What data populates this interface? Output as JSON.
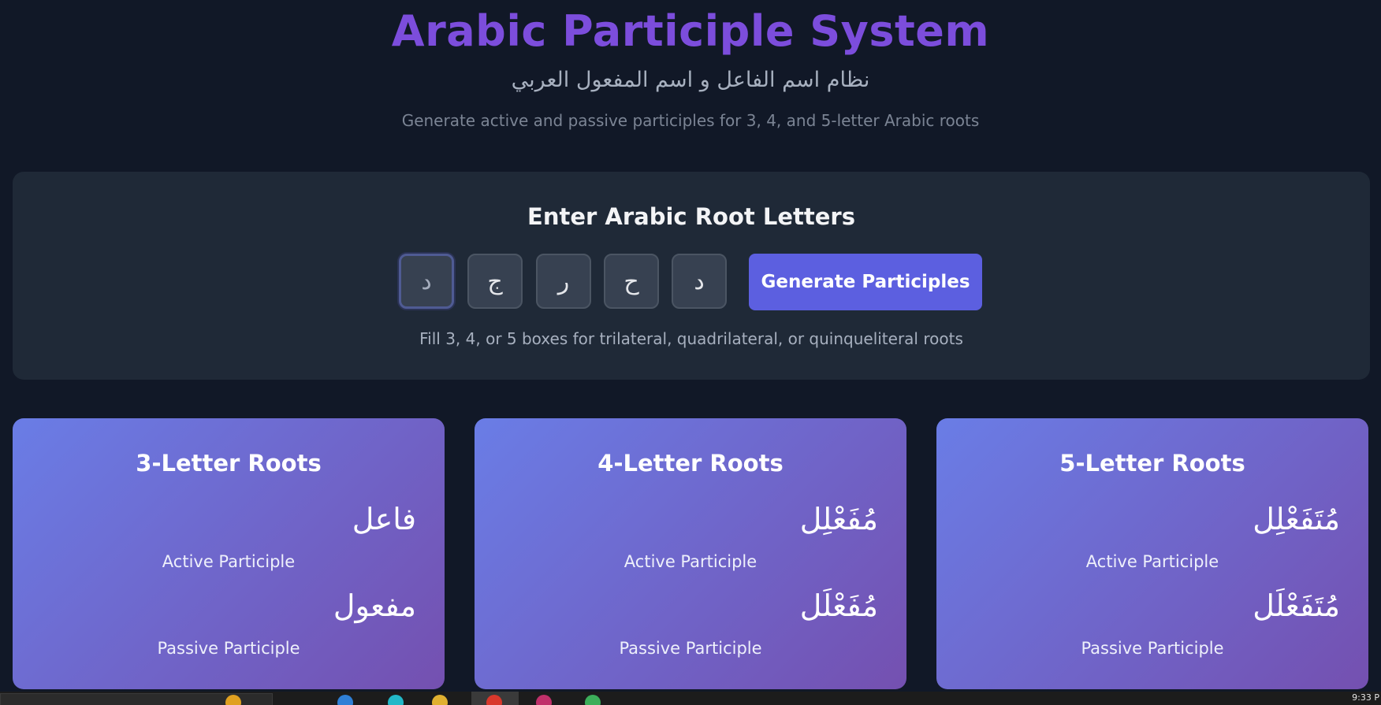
{
  "header": {
    "title": "Arabic Participle System",
    "subtitle_ar": "نظام اسم الفاعل و اسم المفعول العربي",
    "subtitle_en": "Generate active and passive participles for 3, 4, and 5-letter Arabic roots"
  },
  "input_panel": {
    "title": "Enter Arabic Root Letters",
    "letters": [
      "د",
      "ج",
      "ر",
      "ح",
      "د"
    ],
    "button_label": "Generate Participles",
    "hint": "Fill 3, 4, or 5 boxes for trilateral, quadrilateral, or quinqueliteral roots"
  },
  "cards": [
    {
      "title": "3-Letter Roots",
      "active_pattern": "فاعل",
      "active_label": "Active Participle",
      "passive_pattern": "مفعول",
      "passive_label": "Passive Participle"
    },
    {
      "title": "4-Letter Roots",
      "active_pattern": "مُفَعْلِل",
      "active_label": "Active Participle",
      "passive_pattern": "مُفَعْلَل",
      "passive_label": "Passive Participle"
    },
    {
      "title": "5-Letter Roots",
      "active_pattern": "مُتَفَعْلِل",
      "active_label": "Active Participle",
      "passive_pattern": "مُتَفَعْلَل",
      "passive_label": "Passive Participle"
    }
  ],
  "colors": {
    "background": "#111827",
    "panel": "#1f2937",
    "title": "#7c4ddc",
    "button": "#5c5fe0",
    "card_gradient_start": "#6a7de6",
    "card_gradient_end": "#7450b0"
  },
  "taskbar": {
    "clock": "9:33 P"
  }
}
